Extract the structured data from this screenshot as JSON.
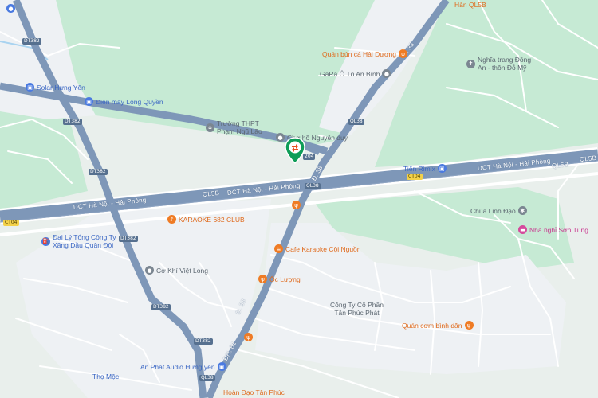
{
  "map": {
    "roads": {
      "highway_main_1": "DCT Hà Nội - Hải Phòng",
      "highway_main_2": "DCT Hà Nội - Hải Phòng",
      "highway_right": "DCT Hà Nội - Hải Phòng",
      "ql5b_left": "QL5B",
      "ql5b_right": "QL5B",
      "ql5b_far": "QL5B",
      "d38_top": "Đ. 38",
      "d38_mid": "Đ. 38",
      "d38_bottom": "Đ. 38",
      "dh61": "ĐH. 61"
    },
    "shields": {
      "dt382_1": "DT382",
      "dt382_2": "DT382",
      "dt382_3": "DT382",
      "dt382_4": "DT382",
      "dt382_5": "DT382",
      "dt382_6": "DT382",
      "ct04_left": "CT04",
      "ct04_right": "CT04",
      "ql38_top": "QL38",
      "ql38_mid": "QL38",
      "ql38_bottom": "QL38",
      "r204": "204"
    },
    "places": {
      "solar": "Solar Hưng Yên",
      "dien_may": "Điện máy Long Quyền",
      "truong_line1": "Trường THPT",
      "truong_line2": "Phạm Ngũ Lão",
      "cho_nguyen": "Chợ hồ Nguyên duy",
      "gara": "GaRa Ô Tô An Bình",
      "quan_bun": "Quán bún cá Hải Dương",
      "han_ql5b": "Hàn QL5B",
      "nghia_trang_line1": "Nghĩa trang Đồng",
      "nghia_trang_line2": "An - thôn Đỗ Mỹ",
      "tien_rimix": "Tiến Rimix",
      "karaoke_682": "KARAOKE 682 CLUB",
      "dai_ly_line1": "Đại Lý Tổng Công Ty",
      "dai_ly_line2": "Xăng Dầu Quân Đội",
      "co_khi": "Cơ Khí Việt Long",
      "cafe_karaoke": "Cafe Karaoke Cội Nguồn",
      "oc_luong": "Ốc Lượng",
      "cong_ty_line1": "Công Ty Cổ Phần",
      "cong_ty_line2": "Tân Phúc Phát",
      "quan_com": "Quán cơm bình dân",
      "chua_linh_dao": "Chùa Linh Đạo",
      "nha_nghi": "Nhà nghỉ Sơn Tùng",
      "an_phat": "An Phát Audio Hưng yên",
      "tho_moc": "Thọ Mộc",
      "hoan_dao": "Hoàn Đạo Tân Phúc"
    },
    "colors": {
      "land": "#e8f0e9",
      "green": "#c7ead6",
      "main_road": "#7d96b8",
      "minor_road": "#ffffff",
      "water": "#a9d3f0"
    }
  }
}
